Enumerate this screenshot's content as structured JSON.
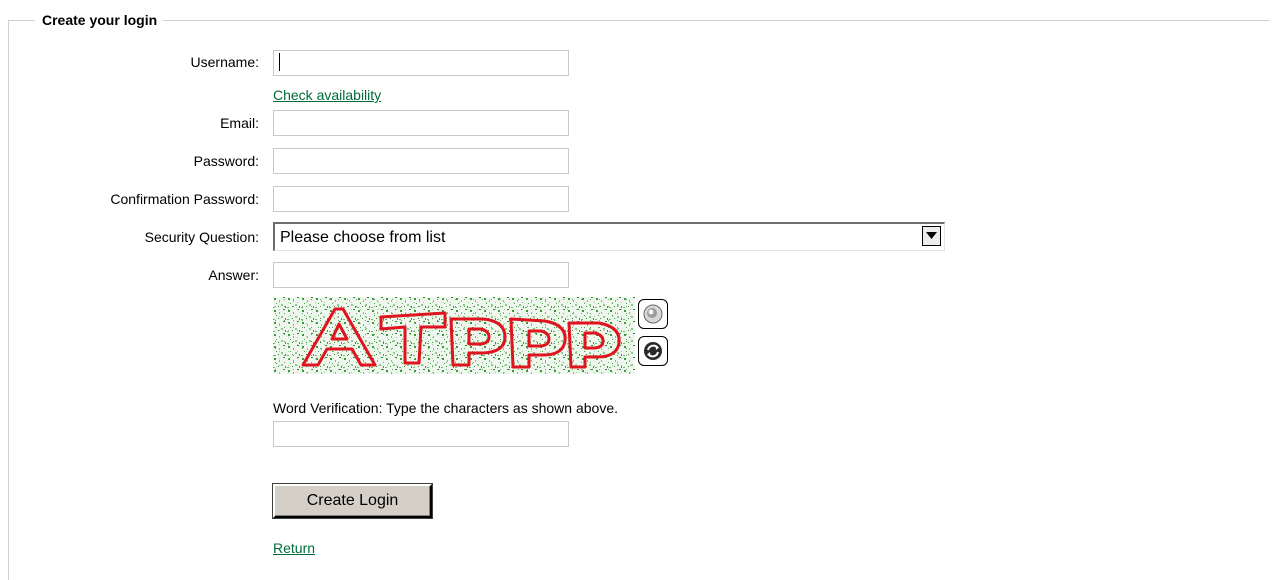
{
  "form": {
    "legend": "Create your login",
    "fields": {
      "username": {
        "label": "Username:",
        "value": ""
      },
      "email": {
        "label": "Email:",
        "value": ""
      },
      "password": {
        "label": "Password:",
        "value": ""
      },
      "confirm": {
        "label": "Confirmation Password:",
        "value": ""
      },
      "security_question": {
        "label": "Security Question:",
        "selected": "Please choose from list"
      },
      "answer": {
        "label": "Answer:",
        "value": ""
      }
    },
    "check_availability": "Check availability",
    "captcha": {
      "text": "ATPPP",
      "audio_icon": "speaker-icon",
      "refresh_icon": "refresh-icon",
      "hint": "Word Verification: Type the characters as shown above.",
      "value": ""
    },
    "submit_label": "Create Login",
    "return_label": "Return"
  },
  "colors": {
    "link": "#006a3a",
    "captcha_text": "#e0141e",
    "captcha_noise": "#3a9a3a",
    "frame": "#cfcfcf",
    "button_face": "#d4d0c8"
  }
}
